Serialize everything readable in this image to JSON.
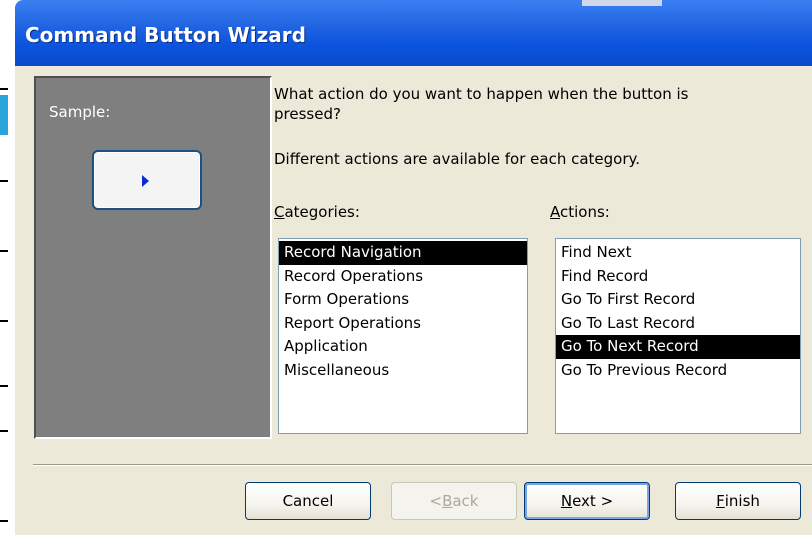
{
  "window": {
    "title": "Command Button Wizard"
  },
  "sample": {
    "label": "Sample:"
  },
  "prompt": {
    "question": "What action do you want to happen when the button is pressed?",
    "note": "Different actions are available for each category."
  },
  "categories": {
    "label_accel": "C",
    "label_rest": "ategories:",
    "items": [
      {
        "label": "Record Navigation",
        "selected": true
      },
      {
        "label": "Record Operations",
        "selected": false
      },
      {
        "label": "Form Operations",
        "selected": false
      },
      {
        "label": "Report Operations",
        "selected": false
      },
      {
        "label": "Application",
        "selected": false
      },
      {
        "label": "Miscellaneous",
        "selected": false
      }
    ]
  },
  "actions": {
    "label_accel": "A",
    "label_rest": "ctions:",
    "items": [
      {
        "label": "Find Next",
        "selected": false
      },
      {
        "label": "Find Record",
        "selected": false
      },
      {
        "label": "Go To First Record",
        "selected": false
      },
      {
        "label": "Go To Last Record",
        "selected": false
      },
      {
        "label": "Go To Next Record",
        "selected": true
      },
      {
        "label": "Go To Previous Record",
        "selected": false
      }
    ]
  },
  "buttons": {
    "cancel": "Cancel",
    "back_pre": "< ",
    "back_accel": "B",
    "back_rest": "ack",
    "next_accel": "N",
    "next_rest": "ext >",
    "finish_accel": "F",
    "finish_rest": "inish"
  },
  "icons": {
    "sample_button_icon": "play-arrow-icon"
  },
  "colors": {
    "titlebar": "#0b53de",
    "dialog_bg": "#ece9d8",
    "sample_panel": "#7f7f7f",
    "selection": "#000000",
    "arrow": "#0a2ad8"
  }
}
